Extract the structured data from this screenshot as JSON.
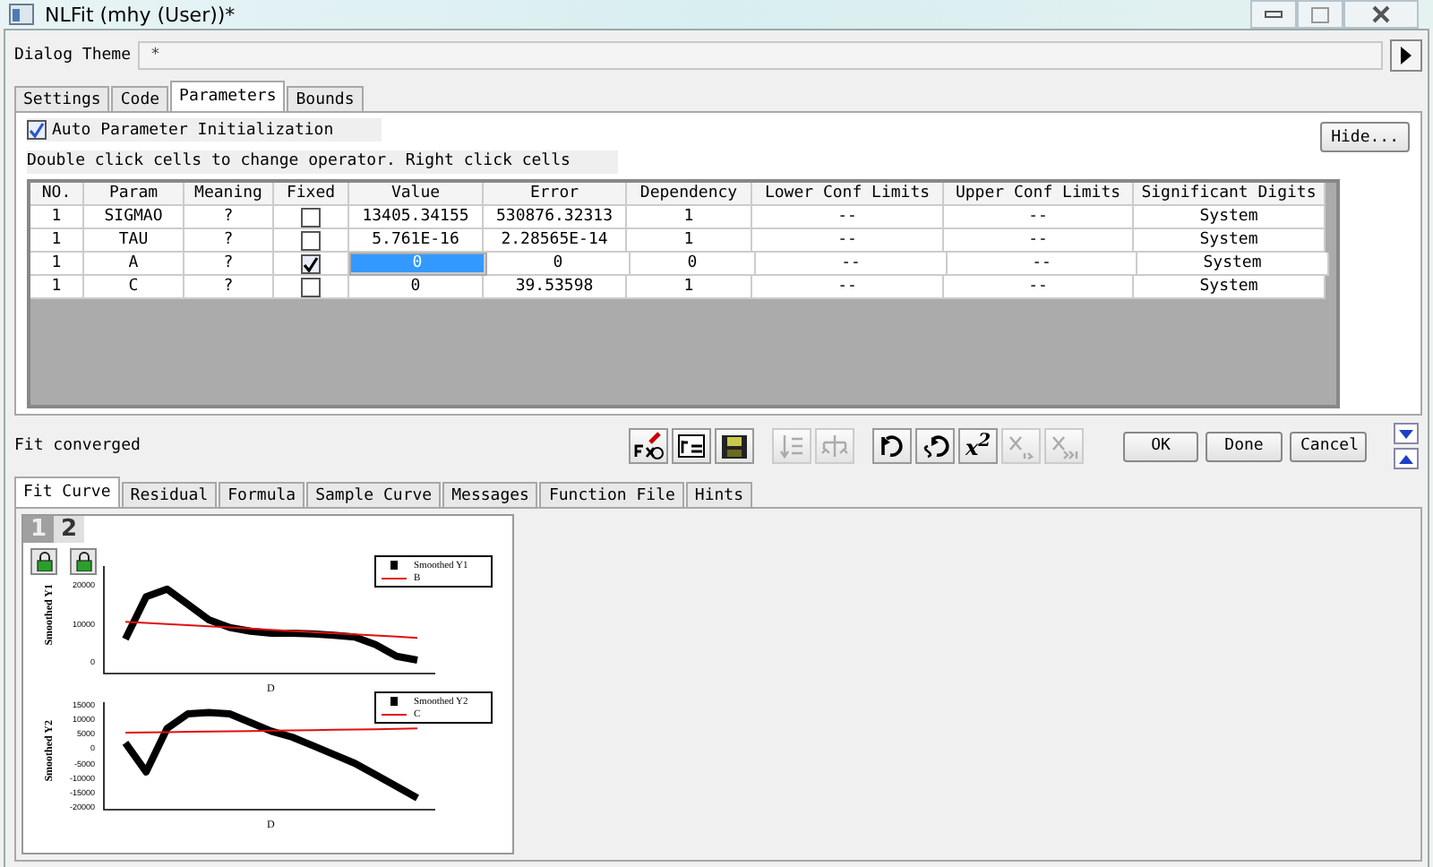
{
  "window": {
    "title": "NLFit (mhy (User))*"
  },
  "theme": {
    "label": "Dialog Theme",
    "value": "*"
  },
  "tabs": [
    {
      "label": "Settings",
      "selected": false
    },
    {
      "label": "Code",
      "selected": false
    },
    {
      "label": "Parameters",
      "selected": true
    },
    {
      "label": "Bounds",
      "selected": false
    }
  ],
  "auto_init": {
    "label": "Auto Parameter Initialization",
    "checked": true
  },
  "hide_button": "Hide...",
  "hint": "Double click cells to change operator. Right click cells",
  "table": {
    "columns": [
      "NO.",
      "Param",
      "Meaning",
      "Fixed",
      "Value",
      "Error",
      "Dependency",
      "Lower Conf Limits",
      "Upper Conf Limits",
      "Significant Digits"
    ],
    "rows": [
      {
        "no": "1",
        "param": "SIGMAO",
        "meaning": "?",
        "fixed": false,
        "value": "13405.34155",
        "error": "530876.32313",
        "dependency": "1",
        "lower": "--",
        "upper": "--",
        "digits": "System",
        "selected": false
      },
      {
        "no": "1",
        "param": "TAU",
        "meaning": "?",
        "fixed": false,
        "value": "5.761E-16",
        "error": "2.28565E-14",
        "dependency": "1",
        "lower": "--",
        "upper": "--",
        "digits": "System",
        "selected": false
      },
      {
        "no": "1",
        "param": "A",
        "meaning": "?",
        "fixed": true,
        "value": "0",
        "error": "0",
        "dependency": "0",
        "lower": "--",
        "upper": "--",
        "digits": "System",
        "selected": true
      },
      {
        "no": "1",
        "param": "C",
        "meaning": "?",
        "fixed": false,
        "value": "0",
        "error": "39.53598",
        "dependency": "1",
        "lower": "--",
        "upper": "--",
        "digits": "System",
        "selected": false
      }
    ]
  },
  "status": "Fit converged",
  "toolbar": [
    {
      "kind": "icon",
      "disabled": false
    },
    {
      "kind": "icon",
      "disabled": false
    },
    {
      "kind": "icon",
      "disabled": false
    },
    {
      "kind": "icon",
      "disabled": true
    },
    {
      "kind": "icon",
      "disabled": true
    },
    {
      "kind": "icon",
      "disabled": false
    },
    {
      "kind": "icon",
      "disabled": false
    },
    {
      "kind": "text",
      "label": "x$^{2}$",
      "disabled": false
    },
    {
      "kind": "icon",
      "disabled": true
    },
    {
      "kind": "icon",
      "disabled": true
    }
  ],
  "buttons": [
    "OK",
    "Done",
    "Cancel"
  ],
  "bottom_tabs": [
    {
      "label": "Fit Curve",
      "selected": true
    },
    {
      "label": "Residual",
      "selected": false
    },
    {
      "label": "Formula",
      "selected": false
    },
    {
      "label": "Sample Curve",
      "selected": false
    },
    {
      "label": "Messages",
      "selected": false
    },
    {
      "label": "Function File",
      "selected": false
    },
    {
      "label": "Hints",
      "selected": false
    }
  ],
  "preview": {
    "pages": [
      {
        "label": "1",
        "selected": true
      },
      {
        "label": "2",
        "selected": false
      }
    ],
    "plots": [
      {
        "chart_data": {
          "type": "line",
          "ylabel": "Smoothed Y1",
          "xlabel": "D",
          "legend": "upper right",
          "ylim": [
            -3000,
            25000
          ],
          "yticks": [
            20000,
            10000,
            0
          ],
          "series": [
            {
              "name": "Smoothed Y1",
              "color": "#000000",
              "values": [
                6000,
                17000,
                19000,
                15000,
                11000,
                9000,
                8000,
                7500,
                7500,
                7300,
                7000,
                6500,
                4500,
                1500,
                500
              ]
            },
            {
              "name": "B",
              "color": "#e01010",
              "values": [
                10500,
                10200,
                9900,
                9600,
                9300,
                9000,
                8700,
                8400,
                8100,
                7800,
                7500,
                7200,
                6900,
                6600,
                6300
              ]
            }
          ]
        }
      },
      {
        "chart_data": {
          "type": "line",
          "ylabel": "Smoothed Y2",
          "xlabel": "D",
          "legend": "upper right",
          "ylim": [
            -21000,
            16000
          ],
          "yticks": [
            15000,
            10000,
            5000,
            0,
            -5000,
            -10000,
            -15000,
            -20000
          ],
          "series": [
            {
              "name": "Smoothed Y2",
              "color": "#000000",
              "values": [
                2000,
                -8000,
                7000,
                12000,
                12500,
                12000,
                9000,
                6000,
                4000,
                1000,
                -2000,
                -5000,
                -9000,
                -13000,
                -17000
              ]
            },
            {
              "name": "C",
              "color": "#e01010",
              "values": [
                5500,
                5600,
                5700,
                5800,
                5900,
                6000,
                6100,
                6200,
                6300,
                6400,
                6500,
                6600,
                6700,
                6800,
                7000
              ]
            }
          ]
        }
      }
    ]
  }
}
